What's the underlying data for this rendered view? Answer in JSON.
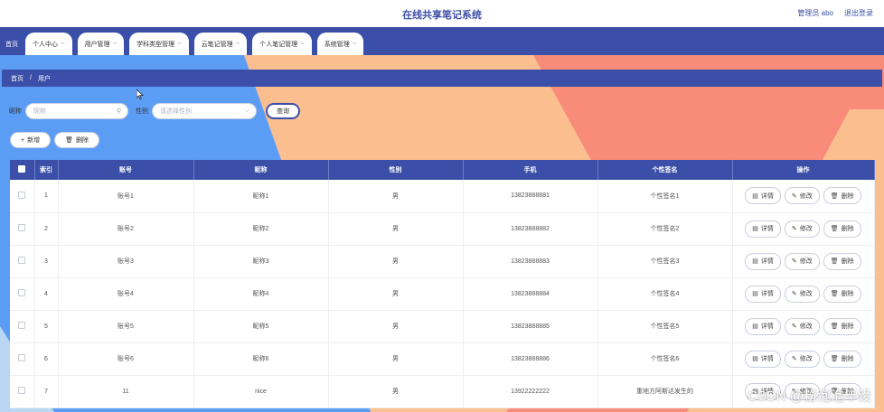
{
  "header": {
    "title": "在线共享笔记系统",
    "admin": "管理员 abo",
    "logout": "退出登录"
  },
  "nav": [
    {
      "label": "首页",
      "dropdown": false
    },
    {
      "label": "个人中心",
      "dropdown": true
    },
    {
      "label": "用户管理",
      "dropdown": true
    },
    {
      "label": "学科类型管理",
      "dropdown": true
    },
    {
      "label": "云笔记管理",
      "dropdown": true
    },
    {
      "label": "个人笔记管理",
      "dropdown": true
    },
    {
      "label": "系统管理",
      "dropdown": true
    }
  ],
  "breadcrumb": {
    "home": "首页",
    "sep": "/",
    "current": "用户"
  },
  "search": {
    "name_label": "昵称",
    "name_placeholder": "昵称",
    "gender_label": "性别",
    "gender_placeholder": "请选择性别",
    "query_button": "查询"
  },
  "actions": {
    "add": "新增",
    "delete": "删除"
  },
  "table": {
    "columns": [
      "索引",
      "账号",
      "昵称",
      "性别",
      "手机",
      "个性签名",
      "操作"
    ],
    "rows": [
      [
        "1",
        "账号1",
        "昵称1",
        "男",
        "13823888881",
        "个性签名1"
      ],
      [
        "2",
        "账号2",
        "昵称2",
        "男",
        "13823888882",
        "个性签名2"
      ],
      [
        "3",
        "账号3",
        "昵称3",
        "男",
        "13823888883",
        "个性签名3"
      ],
      [
        "4",
        "账号4",
        "昵称4",
        "男",
        "13823888884",
        "个性签名4"
      ],
      [
        "5",
        "账号5",
        "昵称5",
        "男",
        "13823888885",
        "个性签名5"
      ],
      [
        "6",
        "账号6",
        "昵称6",
        "男",
        "13823888886",
        "个性签名6"
      ],
      [
        "7",
        "11",
        "nice",
        "男",
        "13922222222",
        "重地方阿斯达发生的"
      ]
    ],
    "op_labels": {
      "detail": "详情",
      "edit": "修改",
      "delete": "删除"
    }
  },
  "watermark": "CSDN @粉泡泡毕设",
  "colors": {
    "primary": "#3b4fa8",
    "blue_bg": "#5b9cf5",
    "peach": "#fbbf8f",
    "coral": "#f98b7b"
  }
}
